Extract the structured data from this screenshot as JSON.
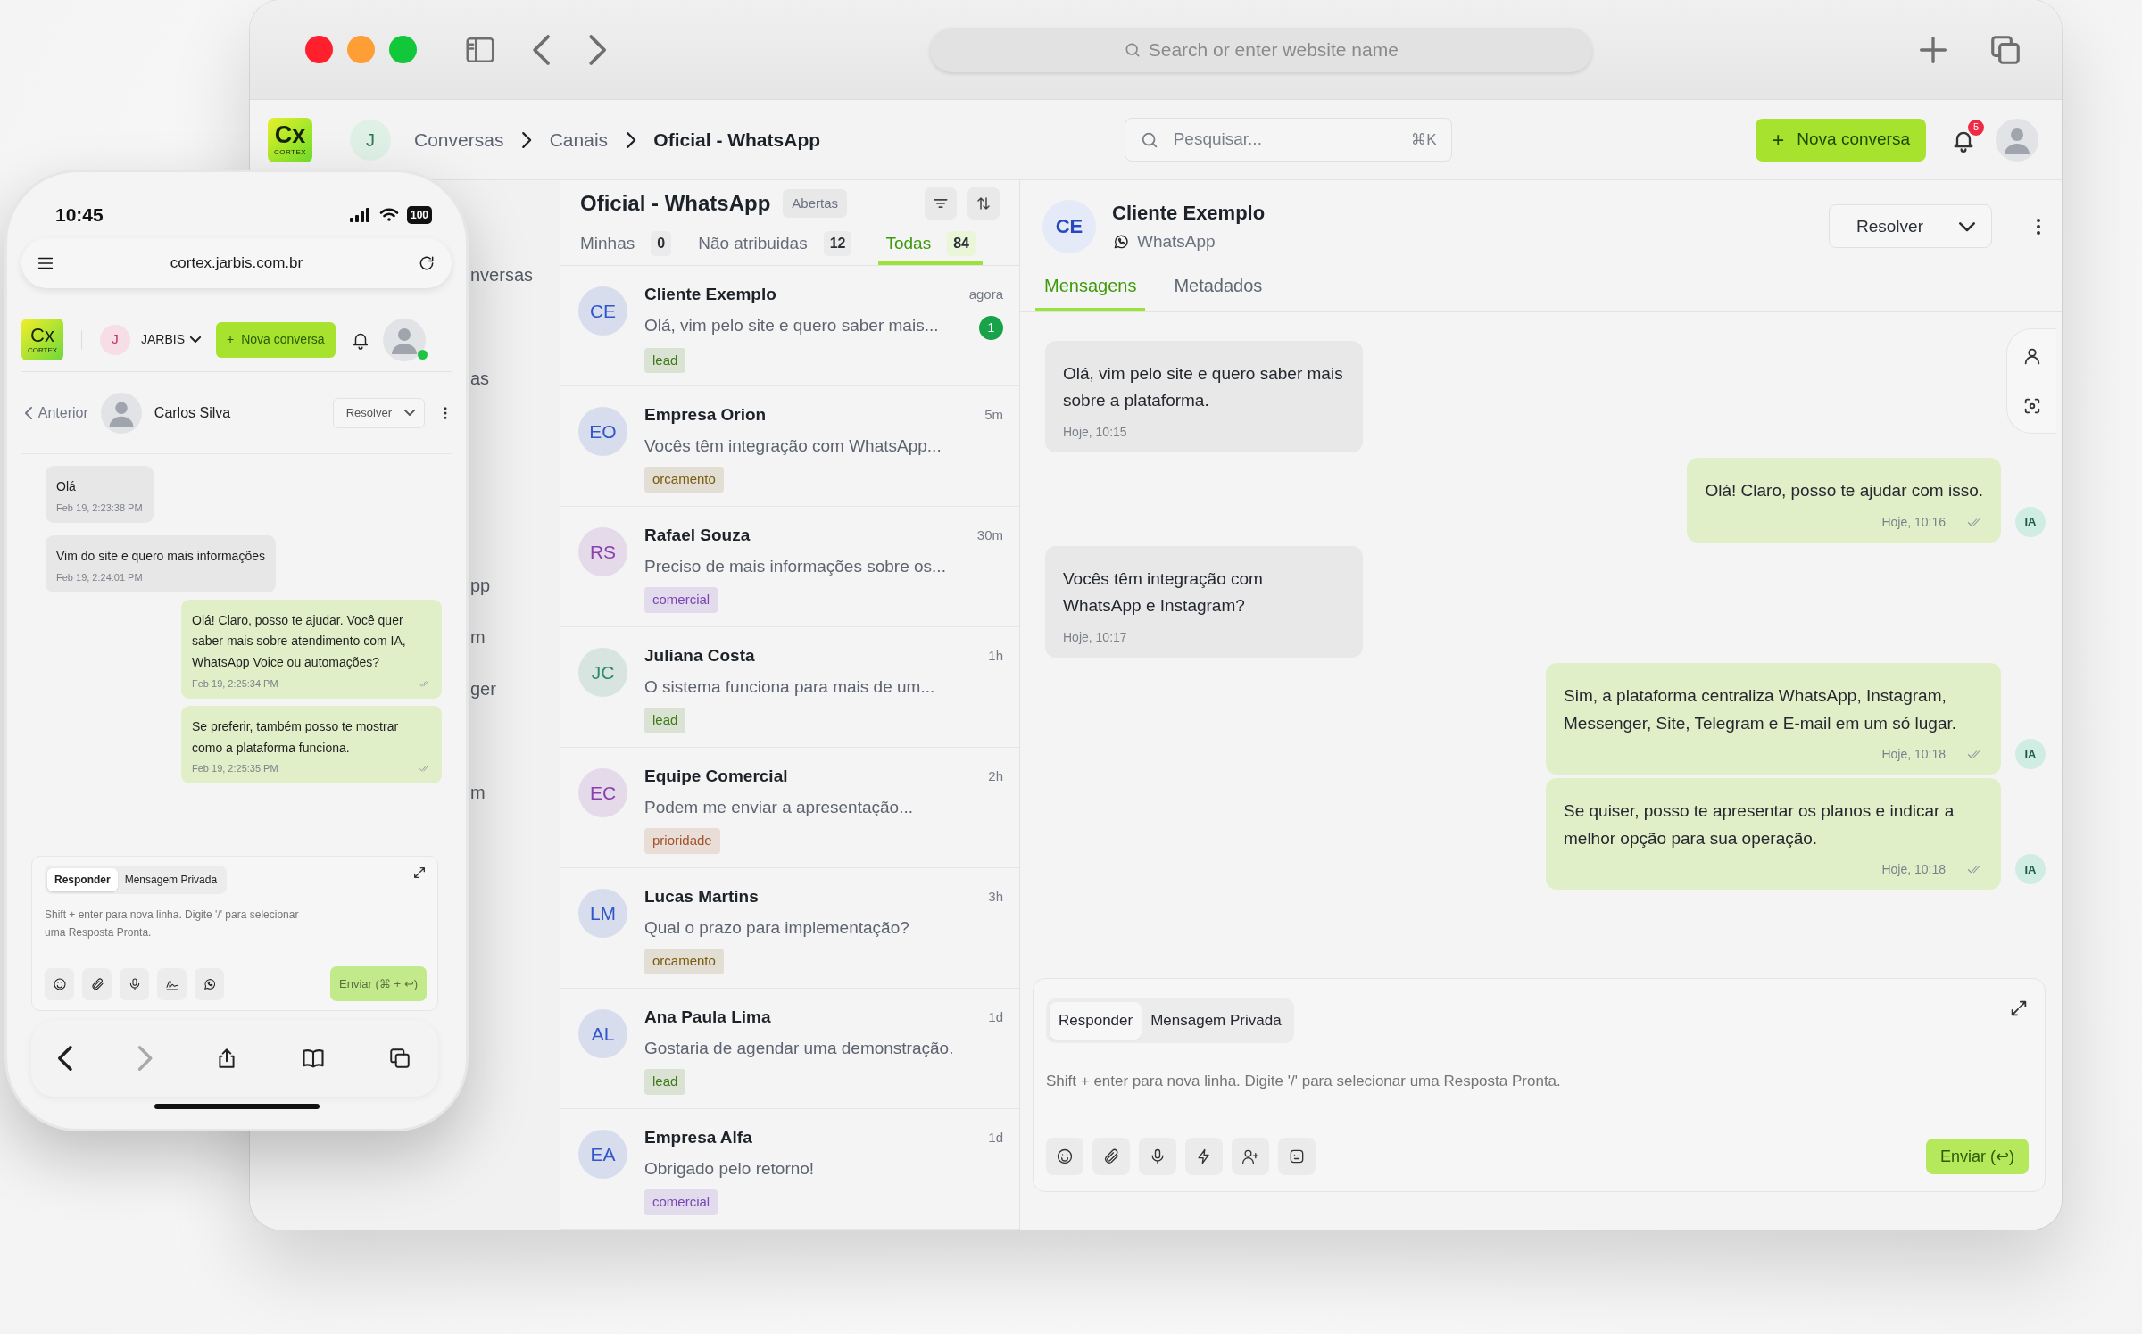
{
  "browser": {
    "address_placeholder": "Search or enter website name"
  },
  "app_header": {
    "logo": "Cx",
    "logo_caption": "CORTEX",
    "account_initial": "J",
    "breadcrumbs": [
      {
        "label": "Conversas",
        "current": false
      },
      {
        "label": "Canais",
        "current": false
      },
      {
        "label": "Oficial - WhatsApp",
        "current": true
      }
    ],
    "search": {
      "placeholder": "Pesquisar...",
      "shortcut": "⌘K"
    },
    "new_conversation": {
      "icon": "+",
      "label": "Nova conversa"
    },
    "notifications": "5"
  },
  "sidebar": {
    "items": [
      "nversas",
      "as",
      "pp",
      "m",
      "ger",
      "m"
    ]
  },
  "conversation_list": {
    "title": "Oficial - WhatsApp",
    "status": "Abertas",
    "tabs": [
      {
        "label": "Minhas",
        "count": "0",
        "selected": false
      },
      {
        "label": "Não atribuidas",
        "count": "12",
        "selected": false
      },
      {
        "label": "Todas",
        "count": "84",
        "selected": true
      }
    ],
    "items": [
      {
        "avatar": {
          "initials": "CE",
          "color": "#3056c9"
        },
        "name": "Cliente Exemplo",
        "preview": "Olá, vim pelo site e quero saber mais...",
        "time": "agora",
        "unread": "1",
        "tag": {
          "label": "lead",
          "color": "#3f7a14"
        }
      },
      {
        "avatar": {
          "initials": "EO",
          "color": "#3056c9"
        },
        "name": "Empresa Orion",
        "preview": "Vocês têm integração com WhatsApp...",
        "time": "5m",
        "tag": {
          "label": "orcamento",
          "color": "#7a5a0c"
        }
      },
      {
        "avatar": {
          "initials": "RS",
          "color": "#8a3fae"
        },
        "name": "Rafael Souza",
        "preview": "Preciso de mais informações sobre os...",
        "time": "30m",
        "tag": {
          "label": "comercial",
          "color": "#7a45b8"
        }
      },
      {
        "avatar": {
          "initials": "JC",
          "color": "#2f8a6a"
        },
        "name": "Juliana Costa",
        "preview": "O sistema funciona para mais de um...",
        "time": "1h",
        "tag": {
          "label": "lead",
          "color": "#3f7a14"
        }
      },
      {
        "avatar": {
          "initials": "EC",
          "color": "#8a3fae"
        },
        "name": "Equipe Comercial",
        "preview": "Podem me enviar a apresentação...",
        "time": "2h",
        "tag": {
          "label": "prioridade",
          "color": "#a4522a"
        }
      },
      {
        "avatar": {
          "initials": "LM",
          "color": "#3056c9"
        },
        "name": "Lucas Martins",
        "preview": "Qual o prazo para implementação?",
        "time": "3h",
        "tag": {
          "label": "orcamento",
          "color": "#7a5a0c"
        }
      },
      {
        "avatar": {
          "initials": "AL",
          "color": "#3056c9"
        },
        "name": "Ana Paula Lima",
        "preview": "Gostaria de agendar uma demonstração.",
        "time": "1d",
        "tag": {
          "label": "lead",
          "color": "#3f7a14"
        }
      },
      {
        "avatar": {
          "initials": "EA",
          "color": "#3056c9"
        },
        "name": "Empresa Alfa",
        "preview": "Obrigado pelo retorno!",
        "time": "1d",
        "tag": {
          "label": "comercial",
          "color": "#7a45b8"
        }
      }
    ]
  },
  "chat": {
    "initials": "CE",
    "name": "Cliente Exemplo",
    "channel": "WhatsApp",
    "resolve": "Resolver",
    "tabs": [
      {
        "label": "Mensagens",
        "selected": true
      },
      {
        "label": "Metadados",
        "selected": false
      }
    ],
    "messages": [
      {
        "kind": "incoming",
        "text": "Olá, vim pelo site e quero saber mais sobre a plataforma.",
        "time": "Hoje, 10:15"
      },
      {
        "kind": "outgoing",
        "text": "Olá! Claro, posso te ajudar com isso.",
        "time": "Hoje, 10:16",
        "sender": "IA"
      },
      {
        "kind": "incoming",
        "text": "Vocês têm integração com WhatsApp e Instagram?",
        "time": "Hoje, 10:17"
      },
      {
        "kind": "outgoing",
        "text": "Sim, a plataforma centraliza WhatsApp, Instagram, Messenger, Site, Telegram e E-mail em um só lugar.",
        "time": "Hoje, 10:18",
        "sender": "IA"
      },
      {
        "kind": "outgoing",
        "text": "Se quiser, posso te apresentar os planos e indicar a melhor opção para sua operação.",
        "time": "Hoje, 10:18",
        "sender": "IA"
      }
    ]
  },
  "composer": {
    "tabs": [
      {
        "label": "Responder",
        "selected": true
      },
      {
        "label": "Mensagem Privada",
        "selected": false
      }
    ],
    "placeholder": "Shift + enter para nova linha. Digite '/' para selecionar uma Resposta Pronta.",
    "send": "Enviar (↩)"
  },
  "phone": {
    "time": "10:45",
    "battery": "100",
    "url": "cortex.jarbis.com.br",
    "logo": "Cx",
    "logo_caption": "CORTEX",
    "account_initial": "J",
    "account": "JARBIS",
    "new_conversation": {
      "icon": "+",
      "label": "Nova conversa"
    },
    "back": "Anterior",
    "contact": "Carlos Silva",
    "resolve": "Resolver",
    "messages": [
      {
        "kind": "incoming",
        "text": "Olá",
        "time": "Feb 19, 2:23:38 PM"
      },
      {
        "kind": "incoming",
        "text": "Vim do site e quero mais informações",
        "time": "Feb 19, 2:24:01 PM"
      },
      {
        "kind": "outgoing",
        "text": "Olá! Claro, posso te ajudar. Você quer saber mais sobre atendimento com IA, WhatsApp Voice ou automações?",
        "time": "Feb 19, 2:25:34 PM"
      },
      {
        "kind": "outgoing",
        "text": "Se preferir, também posso te mostrar como a plataforma funciona.",
        "time": "Feb 19, 2:25:35 PM"
      }
    ],
    "composer": {
      "tabs": [
        {
          "label": "Responder",
          "selected": true
        },
        {
          "label": "Mensagem Privada",
          "selected": false
        }
      ],
      "placeholder": "Shift + enter para nova linha. Digite '/' para selecionar uma Resposta Pronta.",
      "send": "Enviar (⌘ + ↩)"
    },
    "nav": {
      "back_enabled": true,
      "forward_enabled": false
    }
  }
}
